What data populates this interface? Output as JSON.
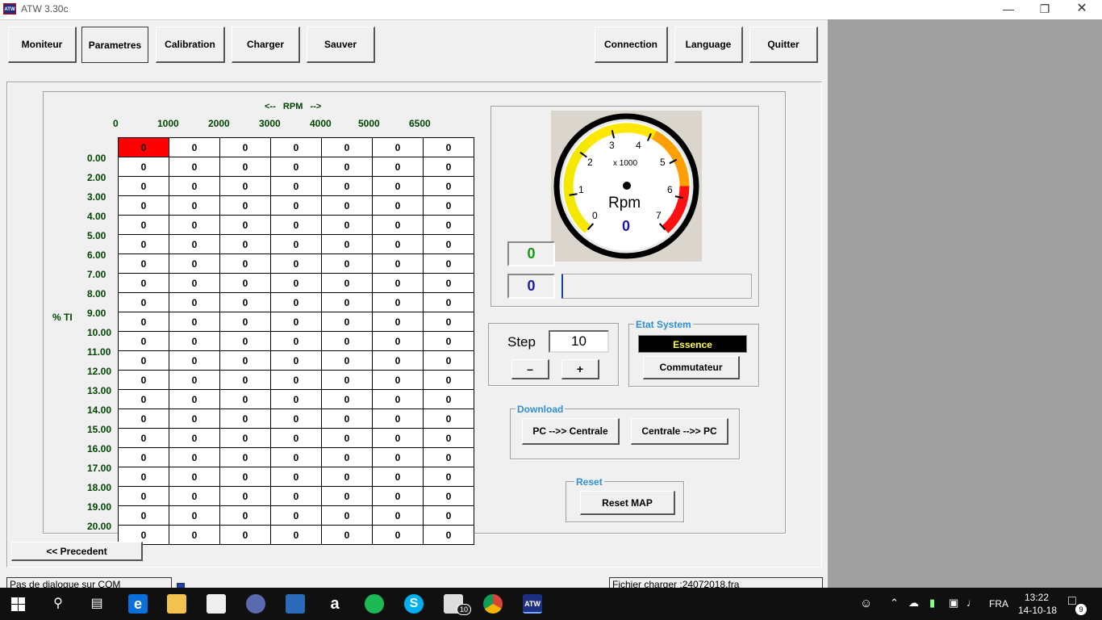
{
  "window": {
    "title": "ATW 3.30c",
    "icon_text": "ATW"
  },
  "toolbar": {
    "moniteur": "Moniteur",
    "parametres": "Parametres",
    "calibration": "Calibration",
    "charger": "Charger",
    "sauver": "Sauver",
    "connection": "Connection",
    "language": "Language",
    "quitter": "Quitter"
  },
  "map": {
    "rpm_title": "<--   RPM   -->",
    "rpm_ticks": [
      "0",
      "1000",
      "2000",
      "3000",
      "4000",
      "5000",
      "6500"
    ],
    "ti_axis_label": "% TI",
    "ti_ticks": [
      "0.00",
      "2.00",
      "3.00",
      "4.00",
      "5.00",
      "6.00",
      "7.00",
      "8.00",
      "9.00",
      "10.00",
      "11.00",
      "12.00",
      "13.00",
      "14.00",
      "15.00",
      "16.00",
      "17.00",
      "18.00",
      "19.00",
      "20.00"
    ],
    "rows": [
      [
        "0",
        "0",
        "0",
        "0",
        "0",
        "0",
        "0"
      ],
      [
        "0",
        "0",
        "0",
        "0",
        "0",
        "0",
        "0"
      ],
      [
        "0",
        "0",
        "0",
        "0",
        "0",
        "0",
        "0"
      ],
      [
        "0",
        "0",
        "0",
        "0",
        "0",
        "0",
        "0"
      ],
      [
        "0",
        "0",
        "0",
        "0",
        "0",
        "0",
        "0"
      ],
      [
        "0",
        "0",
        "0",
        "0",
        "0",
        "0",
        "0"
      ],
      [
        "0",
        "0",
        "0",
        "0",
        "0",
        "0",
        "0"
      ],
      [
        "0",
        "0",
        "0",
        "0",
        "0",
        "0",
        "0"
      ],
      [
        "0",
        "0",
        "0",
        "0",
        "0",
        "0",
        "0"
      ],
      [
        "0",
        "0",
        "0",
        "0",
        "0",
        "0",
        "0"
      ],
      [
        "0",
        "0",
        "0",
        "0",
        "0",
        "0",
        "0"
      ],
      [
        "0",
        "0",
        "0",
        "0",
        "0",
        "0",
        "0"
      ],
      [
        "0",
        "0",
        "0",
        "0",
        "0",
        "0",
        "0"
      ],
      [
        "0",
        "0",
        "0",
        "0",
        "0",
        "0",
        "0"
      ],
      [
        "0",
        "0",
        "0",
        "0",
        "0",
        "0",
        "0"
      ],
      [
        "0",
        "0",
        "0",
        "0",
        "0",
        "0",
        "0"
      ],
      [
        "0",
        "0",
        "0",
        "0",
        "0",
        "0",
        "0"
      ],
      [
        "0",
        "0",
        "0",
        "0",
        "0",
        "0",
        "0"
      ],
      [
        "0",
        "0",
        "0",
        "0",
        "0",
        "0",
        "0"
      ],
      [
        "0",
        "0",
        "0",
        "0",
        "0",
        "0",
        "0"
      ],
      [
        "0",
        "0",
        "0",
        "0",
        "0",
        "0",
        "0"
      ]
    ],
    "selected_cell_color": "#ff0000"
  },
  "gauge": {
    "numbers": [
      "0",
      "1",
      "2",
      "3",
      "4",
      "5",
      "6",
      "7"
    ],
    "multiplier": "x 1000",
    "unit": "Rpm",
    "value": "0",
    "value_color": "#1a1aa0"
  },
  "readouts": {
    "green_value": "0",
    "green_color": "#119911",
    "blue_value": "0",
    "blue_color": "#1a1aa0"
  },
  "step": {
    "label": "Step",
    "value": "10",
    "minus": "–",
    "plus": "+"
  },
  "etat": {
    "title": "Etat System",
    "mode": "Essence",
    "commutateur": "Commutateur"
  },
  "download": {
    "title": "Download",
    "to_centrale": "PC -->> Centrale",
    "to_pc": "Centrale -->> PC"
  },
  "reset": {
    "title": "Reset",
    "button": "Reset MAP"
  },
  "nav": {
    "precedent": "<< Precedent"
  },
  "status": {
    "left": "Pas de dialogue sur COM",
    "right": "Fichier charger :24072018.fra"
  },
  "taskbar": {
    "language": "FRA",
    "time": "13:22",
    "date": "14-10-18",
    "mail_badge": "10",
    "notif_badge": "9"
  }
}
